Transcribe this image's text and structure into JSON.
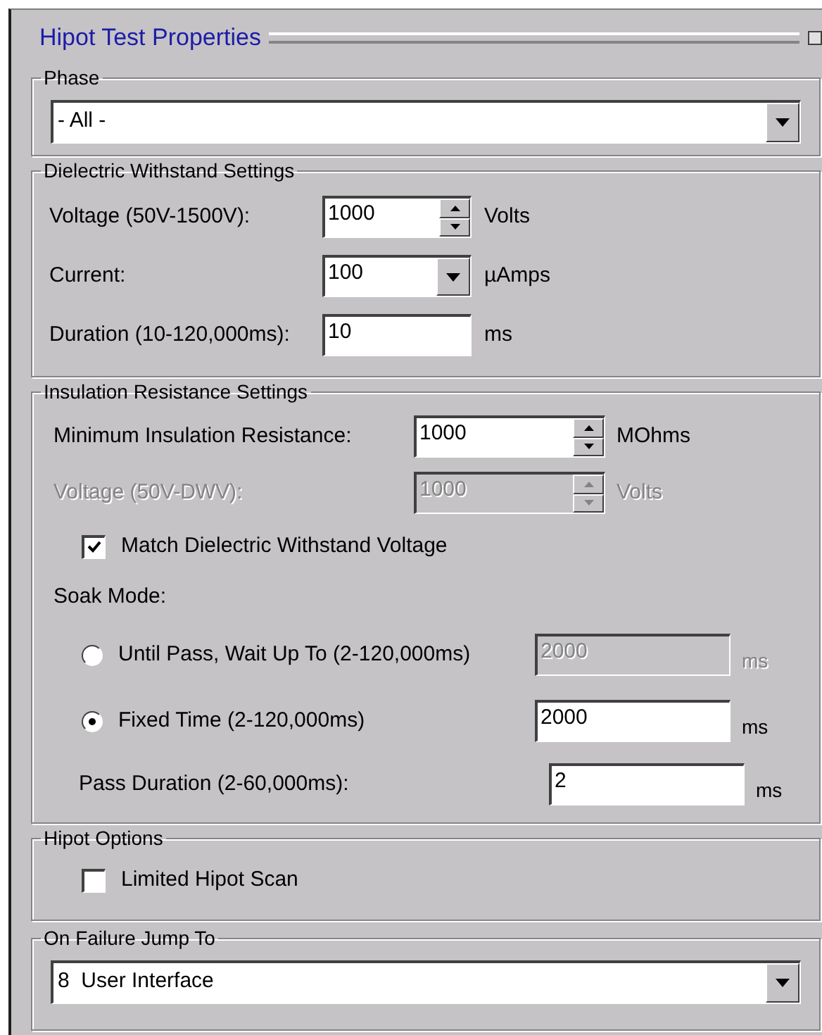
{
  "title": "Hipot Test Properties",
  "phase": {
    "title": "Phase",
    "value": "- All -"
  },
  "dielectric": {
    "title": "Dielectric Withstand Settings",
    "rows": [
      {
        "kind": "spin",
        "label": "Voltage (50V-1500V):",
        "value": "1000",
        "unit": "Volts",
        "disabled": false
      },
      {
        "kind": "dropdown",
        "label": "Current:",
        "value": "100",
        "unit": "µAmps",
        "disabled": false
      },
      {
        "kind": "text",
        "label": "Duration (10-120,000ms):",
        "value": "10",
        "unit": "ms",
        "disabled": false
      }
    ]
  },
  "insulation": {
    "title": "Insulation Resistance Settings",
    "rows": [
      {
        "kind": "spin",
        "label": "Minimum Insulation Resistance:",
        "value": "1000",
        "unit": "MOhms",
        "disabled": false
      },
      {
        "kind": "spin",
        "label": "Voltage (50V-DWV):",
        "value": "1000",
        "unit": "Volts",
        "disabled": true
      }
    ],
    "match": {
      "label": "Match Dielectric Withstand Voltage",
      "checked": true
    },
    "soak_label": "Soak Mode:",
    "soak_options": [
      {
        "label": "Until Pass, Wait Up To (2-120,000ms)",
        "selected": false,
        "value": "2000",
        "unit": "ms",
        "disabled": true
      },
      {
        "label": "Fixed Time (2-120,000ms)",
        "selected": true,
        "value": "2000",
        "unit": "ms",
        "disabled": false
      }
    ],
    "pass_duration": {
      "label": "Pass Duration (2-60,000ms):",
      "value": "2",
      "unit": "ms",
      "disabled": false
    }
  },
  "hipot_options": {
    "title": "Hipot Options",
    "checkboxes": [
      {
        "label": "Limited Hipot Scan",
        "checked": false
      }
    ]
  },
  "on_failure": {
    "title": "On Failure Jump To",
    "value": "8  User Interface"
  }
}
